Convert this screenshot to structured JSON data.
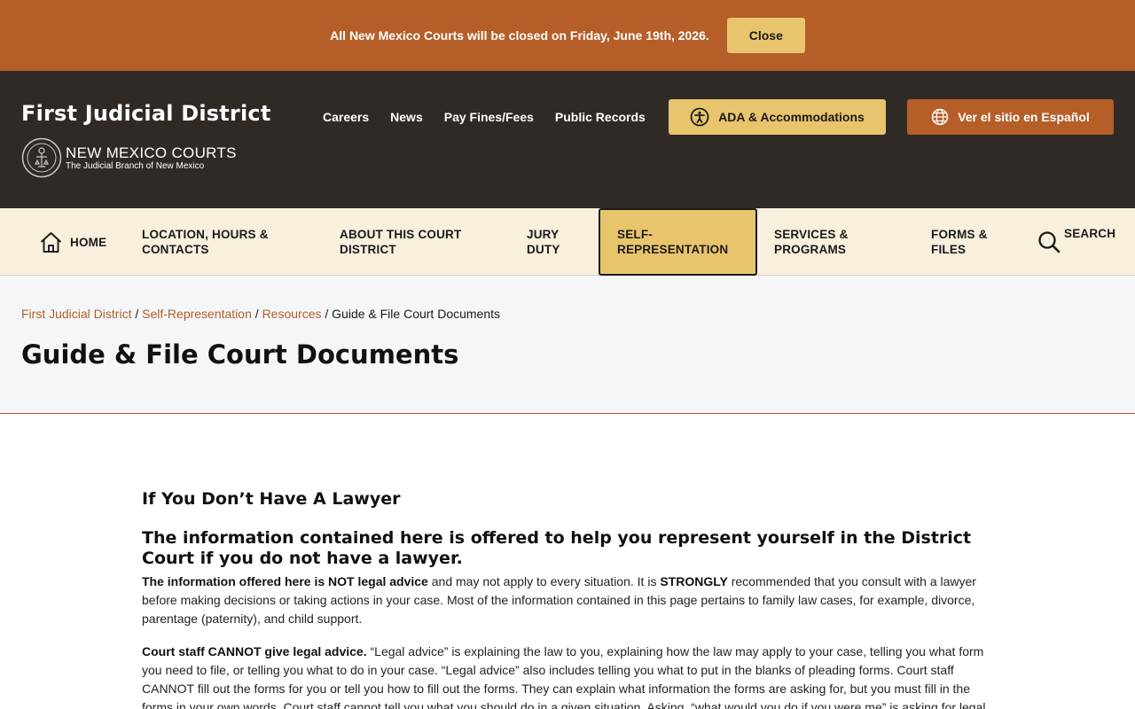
{
  "alert": {
    "message": "All New Mexico Courts will be closed on Friday, June 19th, 2026.",
    "close_label": "Close"
  },
  "header": {
    "site_title": "First Judicial District",
    "brand_name": "NEW MEXICO COURTS",
    "brand_sub": "The Judicial Branch of New Mexico",
    "util_links": [
      "Careers",
      "News",
      "Pay Fines/Fees",
      "Public Records"
    ],
    "ada_label": "ADA & Accommodations",
    "spanish_label": "Ver el sitio en Español"
  },
  "nav": {
    "home": "HOME",
    "location_1": "LOCATION, HOURS &",
    "location_2": "CONTACTS",
    "about_1": "ABOUT THIS COURT",
    "about_2": "DISTRICT",
    "jury_1": "JURY",
    "jury_2": "DUTY",
    "selfrep_1": "SELF-",
    "selfrep_2": "REPRESENTATION",
    "services_1": "SERVICES &",
    "services_2": "PROGRAMS",
    "forms_1": "FORMS &",
    "forms_2": "FILES",
    "search": "SEARCH"
  },
  "breadcrumb": {
    "items": [
      "First Judicial District",
      "Self-Representation",
      "Resources"
    ],
    "separator": "/",
    "current": "Guide & File Court Documents"
  },
  "page_title": "Guide & File Court Documents",
  "content": {
    "heading_lawyer": "If You Don’t Have A Lawyer",
    "heading_info": "The information contained here is offered to help you represent yourself in the District Court if you do not have a lawyer.",
    "p1_bold": "The information offered here is NOT legal advice",
    "p1_text_a": " and may not apply to every situation. It is ",
    "p1_bold2": "STRONGLY",
    "p1_text_b": " recommended that you consult with a lawyer before making decisions or taking actions in your case. Most of the information contained in this page pertains to family law cases, for example, divorce, parentage (paternity), and child support.",
    "p2_bold": "Court staff CANNOT give legal advice.",
    "p2_text": " “Legal advice” is explaining the law to you, explaining how the law may apply to your case, telling you what form you need to file, or telling you what to do in your case. “Legal advice” also includes telling you what to put in the blanks of pleading forms. Court staff CANNOT fill out the forms for you or tell you how to fill out the forms. They can explain what information the forms are asking for, but you must fill in the forms in your own words. Court staff cannot tell you what you should do in a given situation. Asking, “what would you do if you were me” is asking for legal"
  },
  "colors": {
    "banner": "#b55e28",
    "header_bg": "#302a27",
    "accent_gold": "#e8c56d",
    "nav_bg": "#f8efdc",
    "link": "#b55e28"
  },
  "icons": [
    "home-icon",
    "search-icon",
    "accessibility-icon",
    "globe-icon",
    "court-seal-icon"
  ]
}
